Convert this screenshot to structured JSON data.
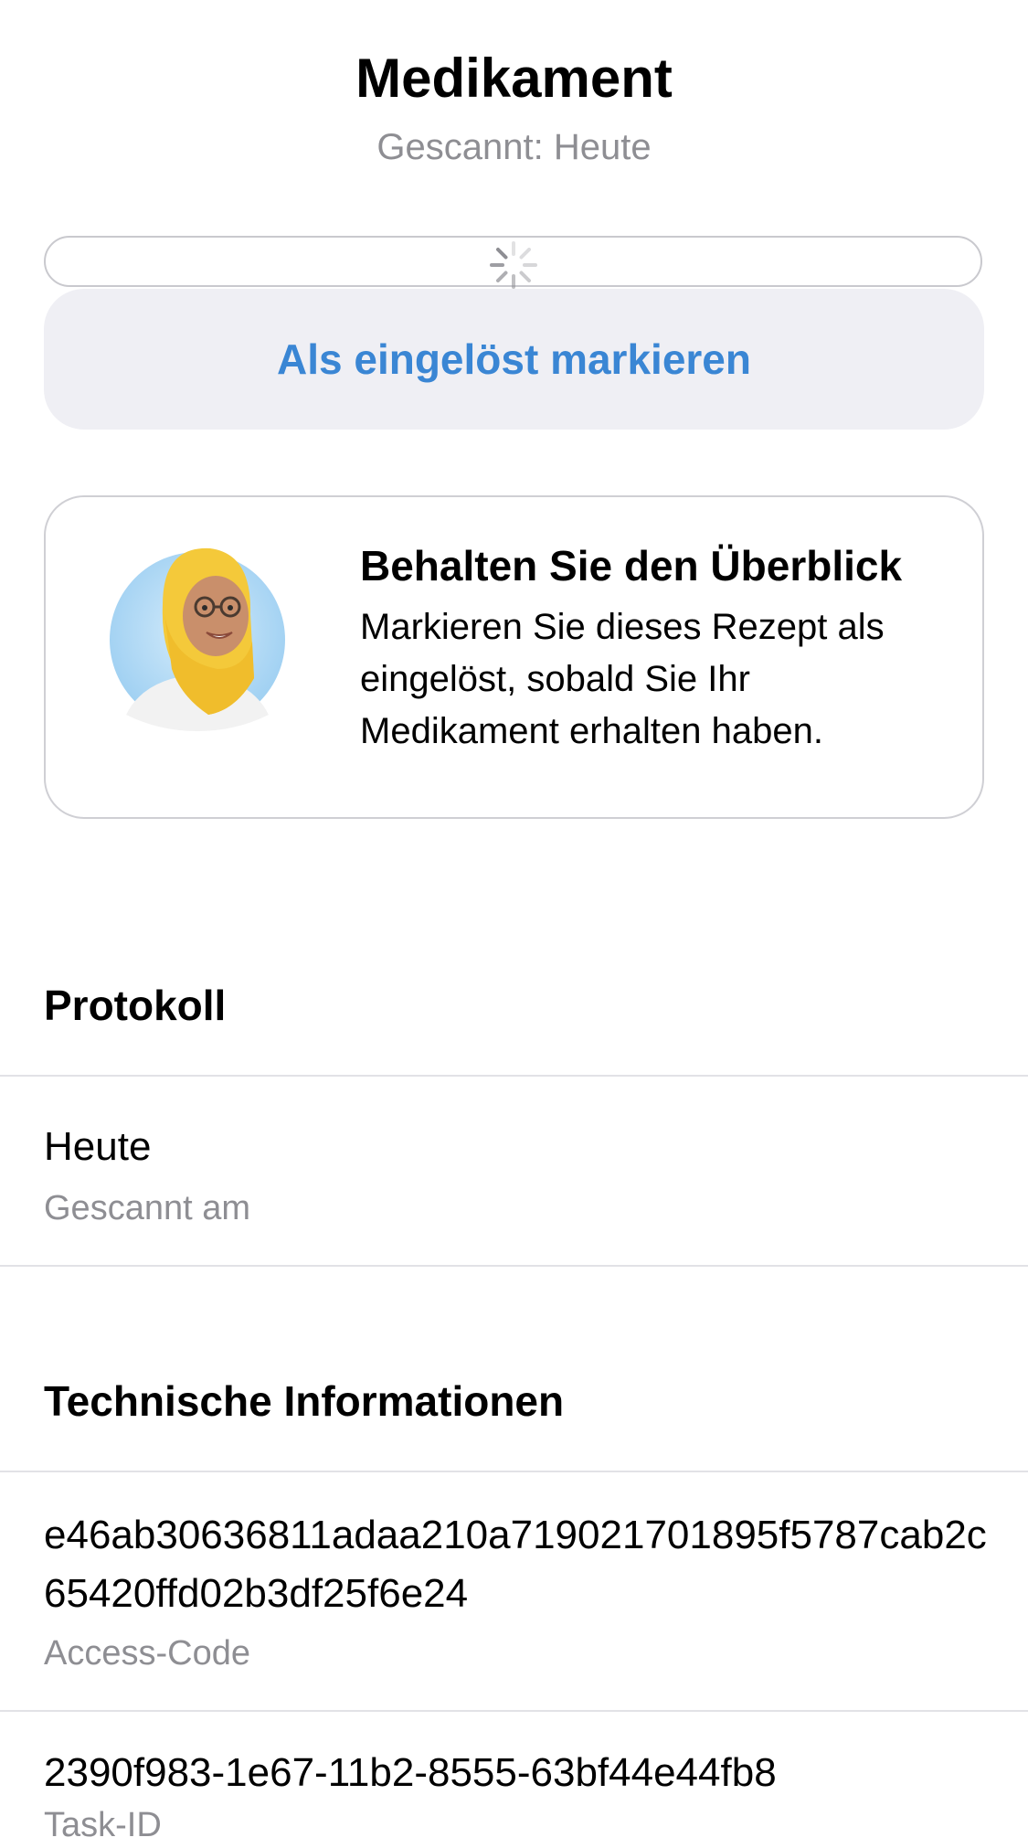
{
  "header": {
    "title": "Medikament",
    "subtitle": "Gescannt: Heute"
  },
  "actions": {
    "redeem_label": "Als eingelöst markieren"
  },
  "hint": {
    "title": "Behalten Sie den Überblick",
    "body": "Markieren Sie dieses Rezept als eingelöst, sobald Sie Ihr Medikament erhalten haben."
  },
  "protocol": {
    "section_title": "Protokoll",
    "items": [
      {
        "value": "Heute",
        "label": "Gescannt am"
      }
    ]
  },
  "technical": {
    "section_title": "Technische Informationen",
    "items": [
      {
        "value": "e46ab30636811adaa210a719021701895f5787cab2c65420ffd02b3df25f6e24",
        "label": "Access-Code"
      },
      {
        "value": "2390f983-1e67-11b2-8555-63bf44e44fb8",
        "label": "Task-ID"
      }
    ]
  },
  "colors": {
    "accent": "#3a86d4",
    "secondary_text": "#8e8e93",
    "button_background": "#efeff4"
  },
  "icons": {
    "spinner": "loading-spinner-icon",
    "avatar": "pharmacist-avatar"
  }
}
